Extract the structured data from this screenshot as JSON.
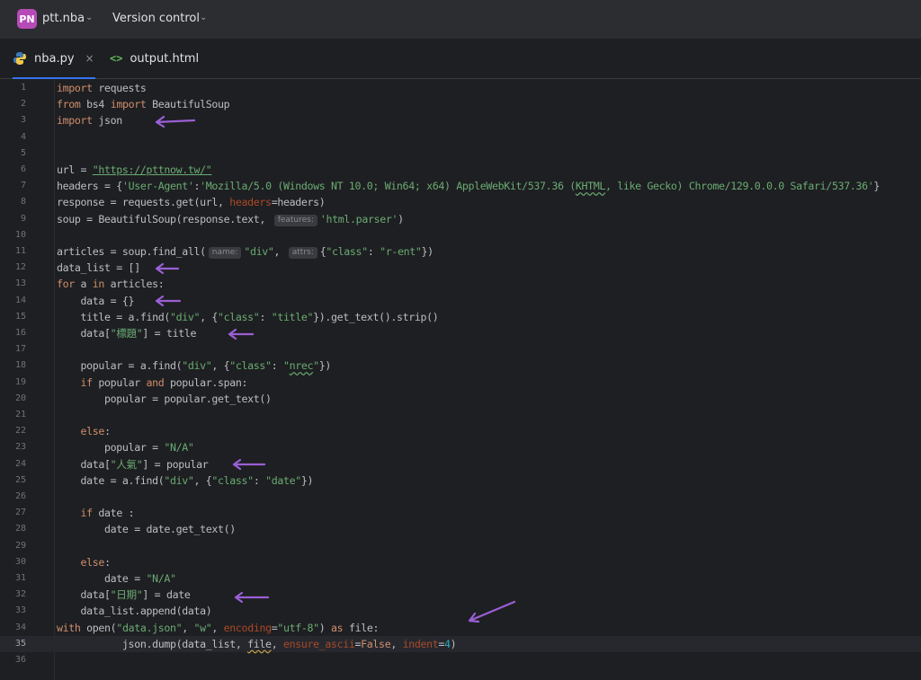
{
  "titlebar": {
    "project_badge": "PN",
    "project_name": "ptt.nba",
    "vcs_label": "Version control"
  },
  "tabs": [
    {
      "label": "nba.py",
      "close": "×",
      "icon": "python-icon"
    },
    {
      "label": "output.html",
      "icon": "html-icon"
    }
  ],
  "hints": {
    "features": "features:",
    "name": "name:",
    "attrs": "attrs:"
  },
  "editor": {
    "line_numbers": [
      "1",
      "2",
      "3",
      "4",
      "5",
      "6",
      "7",
      "8",
      "9",
      "10",
      "11",
      "12",
      "13",
      "14",
      "15",
      "16",
      "17",
      "18",
      "19",
      "20",
      "21",
      "22",
      "23",
      "24",
      "25",
      "26",
      "27",
      "28",
      "29",
      "30",
      "31",
      "32",
      "33",
      "34",
      "35",
      "36"
    ],
    "current_line": 35
  },
  "colors": {
    "keyword": "#cf8e6d",
    "string": "#6aab73",
    "kwarg": "#aa4926",
    "number": "#2aacb8",
    "arrow": "#9a5fd6",
    "accent": "#3574f0"
  }
}
